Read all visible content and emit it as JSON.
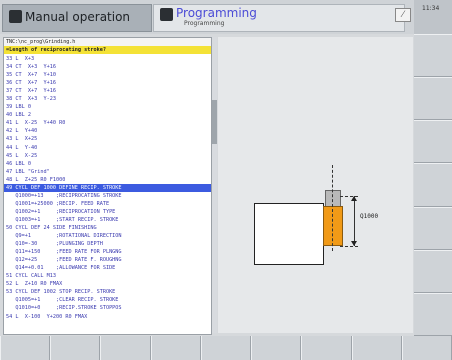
{
  "header": {
    "manual_label": "Manual operation",
    "prog_label": "Programming",
    "prog_sub": "Programming",
    "clock": "11:34"
  },
  "editor": {
    "file_path": "TNC:\\nc_prog\\Grinding.h",
    "prompt": "=Length of reciprocating stroke?",
    "lines": [
      {
        "text": "33 L  X+3",
        "sel": false
      },
      {
        "text": "34 CT  X+3  Y+16",
        "sel": false
      },
      {
        "text": "35 CT  X+7  Y+10",
        "sel": false
      },
      {
        "text": "36 CT  X+7  Y+16",
        "sel": false
      },
      {
        "text": "37 CT  X+7  Y+16",
        "sel": false
      },
      {
        "text": "38 CT  X+3  Y-23",
        "sel": false
      },
      {
        "text": "39 LBL 0",
        "sel": false
      },
      {
        "text": "40 LBL 2",
        "sel": false
      },
      {
        "text": "41 L  X-25  Y+40 R0",
        "sel": false
      },
      {
        "text": "42 L  Y+40",
        "sel": false
      },
      {
        "text": "43 L  X+25",
        "sel": false
      },
      {
        "text": "44 L  Y-40",
        "sel": false
      },
      {
        "text": "45 L  X-25",
        "sel": false
      },
      {
        "text": "46 LBL 0",
        "sel": false
      },
      {
        "text": "47 LBL \"Grind\"",
        "sel": false
      },
      {
        "text": "48 L  Z+25 R0 F1000",
        "sel": false
      },
      {
        "text": "49 CYCL DEF 1000 DEFINE RECIP. STROKE",
        "sel": true
      },
      {
        "text": "   Q1000=+13    ;RECIPROCATING STROKE",
        "sel": false
      },
      {
        "text": "   Q1001=+25000 ;RECIP. FEED RATE",
        "sel": false
      },
      {
        "text": "   Q1002=+1     ;RECIPROCATION TYPE",
        "sel": false
      },
      {
        "text": "   Q1003=+1     ;START RECIP. STROKE",
        "sel": false
      },
      {
        "text": "50 CYCL DEF 24 SIDE FINISHING",
        "sel": false
      },
      {
        "text": "   Q9=+1        ;ROTATIONAL DIRECTION",
        "sel": false
      },
      {
        "text": "   Q10=-30      ;PLUNGING DEPTH",
        "sel": false
      },
      {
        "text": "   Q11=+150     ;FEED RATE FOR PLNGNG",
        "sel": false
      },
      {
        "text": "   Q12=+25      ;FEED RATE F. ROUGHNG",
        "sel": false
      },
      {
        "text": "   Q14=+0.01    ;ALLOWANCE FOR SIDE",
        "sel": false
      },
      {
        "text": "51 CYCL CALL M13",
        "sel": false
      },
      {
        "text": "52 L  Z+10 R0 FMAX",
        "sel": false
      },
      {
        "text": "53 CYCL DEF 1002 STOP RECIP. STROKE",
        "sel": false
      },
      {
        "text": "   Q1005=+1     ;CLEAR RECIP. STROKE",
        "sel": false
      },
      {
        "text": "   Q1010=+0     ;RECIP.STROKE STOPPOS",
        "sel": false
      },
      {
        "text": "54 L  X-100  Y+200 R0 FMAX",
        "sel": false
      }
    ]
  },
  "graphic": {
    "dimension_label": "Q1000",
    "tool_color": "#f19a17"
  },
  "softkeys": {
    "vertical_count": 7,
    "horizontal_count": 9
  }
}
